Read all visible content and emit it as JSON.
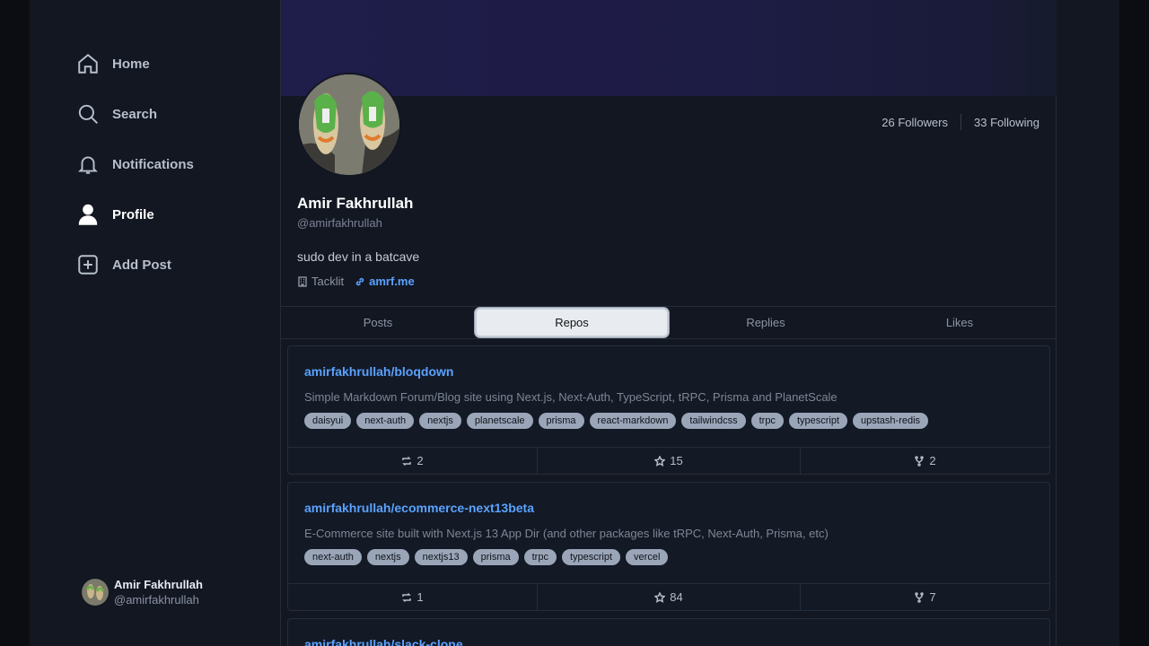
{
  "sidebar": {
    "items": [
      {
        "label": "Home",
        "icon": "home-icon"
      },
      {
        "label": "Search",
        "icon": "search-icon"
      },
      {
        "label": "Notifications",
        "icon": "bell-icon"
      },
      {
        "label": "Profile",
        "icon": "user-icon"
      },
      {
        "label": "Add Post",
        "icon": "plus-square-icon"
      }
    ],
    "user": {
      "name": "Amir Fakhrullah",
      "handle": "@amirfakhrullah"
    }
  },
  "profile": {
    "name": "Amir Fakhrullah",
    "handle": "@amirfakhrullah",
    "bio": "sudo dev in a batcave",
    "org": "Tacklit",
    "website": "amrf.me",
    "followers": "26 Followers",
    "following": "33 Following"
  },
  "tabs": [
    "Posts",
    "Repos",
    "Replies",
    "Likes"
  ],
  "active_tab": "Repos",
  "repos": [
    {
      "name": "amirfakhrullah/bloqdown",
      "description": "Simple Markdown Forum/Blog site using Next.js, Next-Auth, TypeScript, tRPC, Prisma and PlanetScale",
      "tags": [
        "daisyui",
        "next-auth",
        "nextjs",
        "planetscale",
        "prisma",
        "react-markdown",
        "tailwindcss",
        "trpc",
        "typescript",
        "upstash-redis"
      ],
      "reposts": "2",
      "stars": "15",
      "forks": "2"
    },
    {
      "name": "amirfakhrullah/ecommerce-next13beta",
      "description": "E-Commerce site built with Next.js 13 App Dir (and other packages like tRPC, Next-Auth, Prisma, etc)",
      "tags": [
        "next-auth",
        "nextjs",
        "nextjs13",
        "prisma",
        "trpc",
        "typescript",
        "vercel"
      ],
      "reposts": "1",
      "stars": "84",
      "forks": "7"
    },
    {
      "name": "amirfakhrullah/slack-clone"
    }
  ],
  "colors": {
    "accent": "#5aa2ff",
    "background": "#121722",
    "tag": "#9aa6b8"
  }
}
